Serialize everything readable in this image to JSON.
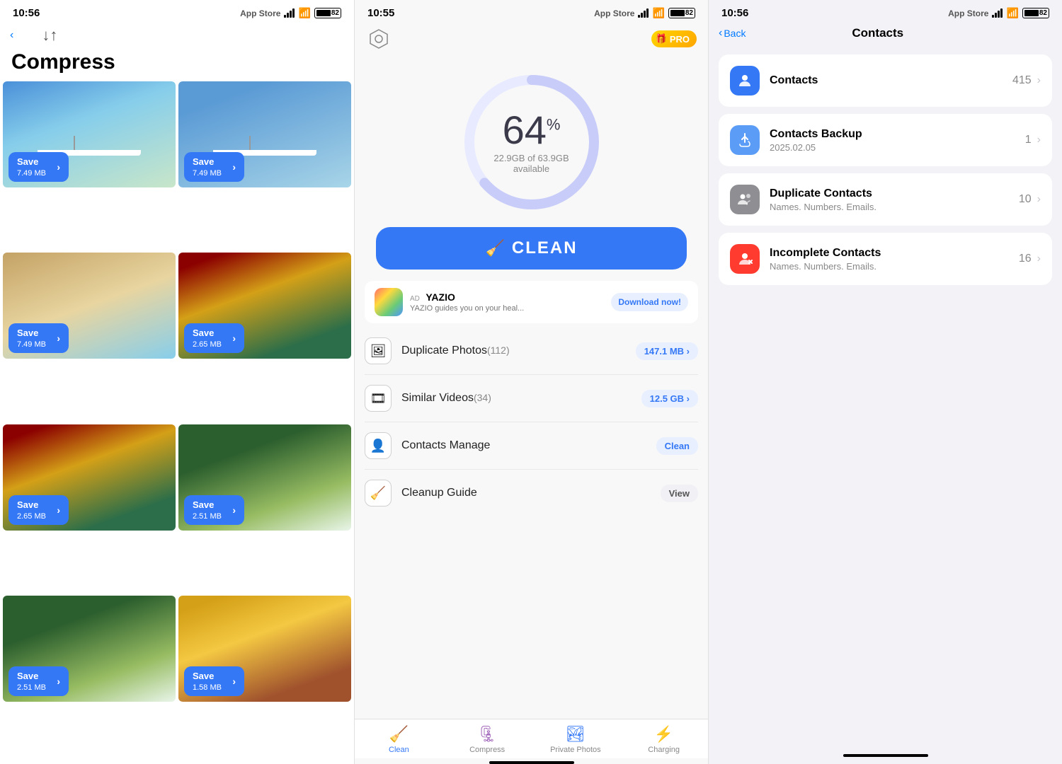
{
  "panel1": {
    "status": {
      "time": "10:56",
      "carrier": "App Store"
    },
    "title": "Compress",
    "sort_icon": "↓↑",
    "photos": [
      {
        "id": 1,
        "bg": "photo-bg-1",
        "save_label": "Save",
        "size": "7.49 MB"
      },
      {
        "id": 2,
        "bg": "photo-bg-2",
        "save_label": "Save",
        "size": "7.49 MB"
      },
      {
        "id": 3,
        "bg": "photo-bg-3",
        "save_label": "Save",
        "size": "7.49 MB"
      },
      {
        "id": 4,
        "bg": "photo-bg-4",
        "save_label": "Save",
        "size": "2.65 MB"
      },
      {
        "id": 5,
        "bg": "photo-bg-5",
        "save_label": "Save",
        "size": "2.65 MB"
      },
      {
        "id": 6,
        "bg": "photo-bg-6",
        "save_label": "Save",
        "size": "2.51 MB"
      },
      {
        "id": 7,
        "bg": "photo-bg-7",
        "save_label": "Save",
        "size": "2.51 MB"
      },
      {
        "id": 8,
        "bg": "photo-bg-8",
        "save_label": "Save",
        "size": "1.58 MB"
      }
    ]
  },
  "panel2": {
    "status": {
      "time": "10:55",
      "carrier": "App Store"
    },
    "pro_label": "PRO",
    "storage": {
      "percent": "64",
      "unit": "%",
      "used": "22.9GB",
      "total": "63.9GB",
      "label": "available",
      "circle_progress": 0.64
    },
    "clean_button": "CLEAN",
    "ad": {
      "ad_label": "AD",
      "name": "YAZIO",
      "description": "YAZIO guides you on your heal...",
      "download_label": "Download now!"
    },
    "features": [
      {
        "id": "dup-photos",
        "name": "Duplicate Photos",
        "count": "(112)",
        "badge": "147.1 MB ›",
        "badge_type": "blue"
      },
      {
        "id": "sim-videos",
        "name": "Similar Videos",
        "count": "(34)",
        "badge": "12.5 GB ›",
        "badge_type": "blue"
      },
      {
        "id": "contacts",
        "name": "Contacts Manage",
        "badge": "Clean",
        "badge_type": "clean"
      },
      {
        "id": "cleanup",
        "name": "Cleanup Guide",
        "badge": "View",
        "badge_type": "view"
      }
    ],
    "tabs": [
      {
        "id": "clean",
        "label": "Clean",
        "active": true
      },
      {
        "id": "compress",
        "label": "Compress",
        "active": false
      },
      {
        "id": "private",
        "label": "Private Photos",
        "active": false
      },
      {
        "id": "charging",
        "label": "Charging",
        "active": false
      }
    ]
  },
  "panel3": {
    "status": {
      "time": "10:56",
      "carrier": "App Store"
    },
    "back_label": "Back",
    "title": "Contacts",
    "items": [
      {
        "id": "contacts",
        "name": "Contacts",
        "icon_type": "blue",
        "count": "415",
        "has_sub": false
      },
      {
        "id": "backup",
        "name": "Contacts Backup",
        "sub": "2025.02.05",
        "icon_type": "blue-light",
        "count": "1",
        "has_sub": true
      },
      {
        "id": "duplicate",
        "name": "Duplicate Contacts",
        "sub": "Names. Numbers. Emails.",
        "icon_type": "gray",
        "count": "10",
        "has_sub": true
      },
      {
        "id": "incomplete",
        "name": "Incomplete Contacts",
        "sub": "Names. Numbers. Emails.",
        "icon_type": "red",
        "count": "16",
        "has_sub": true
      }
    ]
  }
}
